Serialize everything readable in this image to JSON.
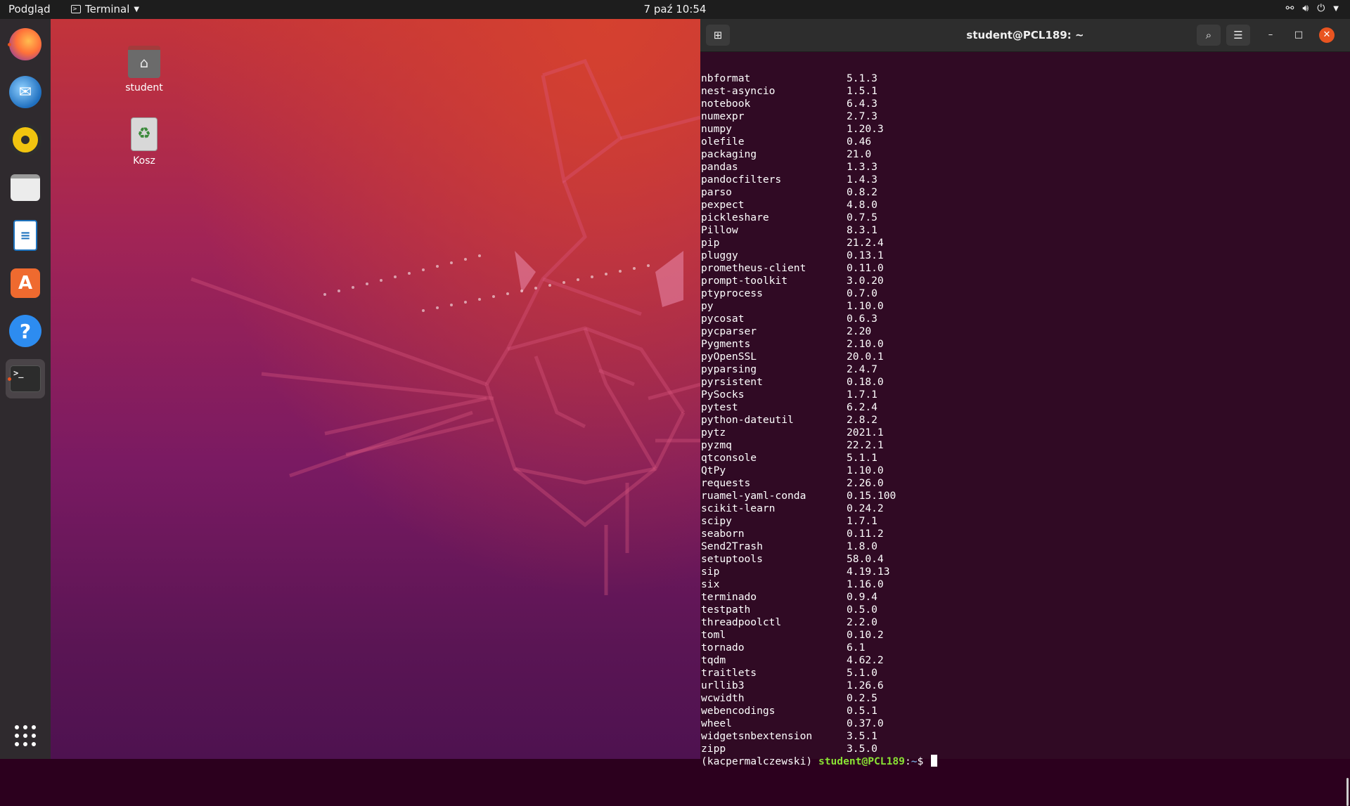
{
  "topbar": {
    "activities": "Podgląd",
    "app_name": "Terminal",
    "clock": "7 paź  10:54"
  },
  "desktop": {
    "icons": [
      {
        "label": "student"
      },
      {
        "label": "Kosz"
      }
    ]
  },
  "terminal": {
    "title": "student@PCL189: ~",
    "packages": [
      {
        "name": "nbformat",
        "version": "5.1.3"
      },
      {
        "name": "nest-asyncio",
        "version": "1.5.1"
      },
      {
        "name": "notebook",
        "version": "6.4.3"
      },
      {
        "name": "numexpr",
        "version": "2.7.3"
      },
      {
        "name": "numpy",
        "version": "1.20.3"
      },
      {
        "name": "olefile",
        "version": "0.46"
      },
      {
        "name": "packaging",
        "version": "21.0"
      },
      {
        "name": "pandas",
        "version": "1.3.3"
      },
      {
        "name": "pandocfilters",
        "version": "1.4.3"
      },
      {
        "name": "parso",
        "version": "0.8.2"
      },
      {
        "name": "pexpect",
        "version": "4.8.0"
      },
      {
        "name": "pickleshare",
        "version": "0.7.5"
      },
      {
        "name": "Pillow",
        "version": "8.3.1"
      },
      {
        "name": "pip",
        "version": "21.2.4"
      },
      {
        "name": "pluggy",
        "version": "0.13.1"
      },
      {
        "name": "prometheus-client",
        "version": "0.11.0"
      },
      {
        "name": "prompt-toolkit",
        "version": "3.0.20"
      },
      {
        "name": "ptyprocess",
        "version": "0.7.0"
      },
      {
        "name": "py",
        "version": "1.10.0"
      },
      {
        "name": "pycosat",
        "version": "0.6.3"
      },
      {
        "name": "pycparser",
        "version": "2.20"
      },
      {
        "name": "Pygments",
        "version": "2.10.0"
      },
      {
        "name": "pyOpenSSL",
        "version": "20.0.1"
      },
      {
        "name": "pyparsing",
        "version": "2.4.7"
      },
      {
        "name": "pyrsistent",
        "version": "0.18.0"
      },
      {
        "name": "PySocks",
        "version": "1.7.1"
      },
      {
        "name": "pytest",
        "version": "6.2.4"
      },
      {
        "name": "python-dateutil",
        "version": "2.8.2"
      },
      {
        "name": "pytz",
        "version": "2021.1"
      },
      {
        "name": "pyzmq",
        "version": "22.2.1"
      },
      {
        "name": "qtconsole",
        "version": "5.1.1"
      },
      {
        "name": "QtPy",
        "version": "1.10.0"
      },
      {
        "name": "requests",
        "version": "2.26.0"
      },
      {
        "name": "ruamel-yaml-conda",
        "version": "0.15.100"
      },
      {
        "name": "scikit-learn",
        "version": "0.24.2"
      },
      {
        "name": "scipy",
        "version": "1.7.1"
      },
      {
        "name": "seaborn",
        "version": "0.11.2"
      },
      {
        "name": "Send2Trash",
        "version": "1.8.0"
      },
      {
        "name": "setuptools",
        "version": "58.0.4"
      },
      {
        "name": "sip",
        "version": "4.19.13"
      },
      {
        "name": "six",
        "version": "1.16.0"
      },
      {
        "name": "terminado",
        "version": "0.9.4"
      },
      {
        "name": "testpath",
        "version": "0.5.0"
      },
      {
        "name": "threadpoolctl",
        "version": "2.2.0"
      },
      {
        "name": "toml",
        "version": "0.10.2"
      },
      {
        "name": "tornado",
        "version": "6.1"
      },
      {
        "name": "tqdm",
        "version": "4.62.2"
      },
      {
        "name": "traitlets",
        "version": "5.1.0"
      },
      {
        "name": "urllib3",
        "version": "1.26.6"
      },
      {
        "name": "wcwidth",
        "version": "0.2.5"
      },
      {
        "name": "webencodings",
        "version": "0.5.1"
      },
      {
        "name": "wheel",
        "version": "0.37.0"
      },
      {
        "name": "widgetsnbextension",
        "version": "3.5.1"
      },
      {
        "name": "zipp",
        "version": "3.5.0"
      }
    ],
    "prompt": {
      "env": "(kacpermalczewski) ",
      "user_host": "student@PCL189",
      "sep": ":",
      "path": "~",
      "symbol": "$ "
    }
  },
  "dock": {
    "apps": [
      "firefox-icon",
      "thunderbird-icon",
      "rhythmbox-icon",
      "files-icon",
      "writer-icon",
      "software-icon",
      "help-icon",
      "terminal-icon"
    ]
  },
  "colors": {
    "terminal_bg": "#300a24",
    "prompt_user": "#8ae234",
    "prompt_path": "#729fcf",
    "accent": "#e95420"
  }
}
